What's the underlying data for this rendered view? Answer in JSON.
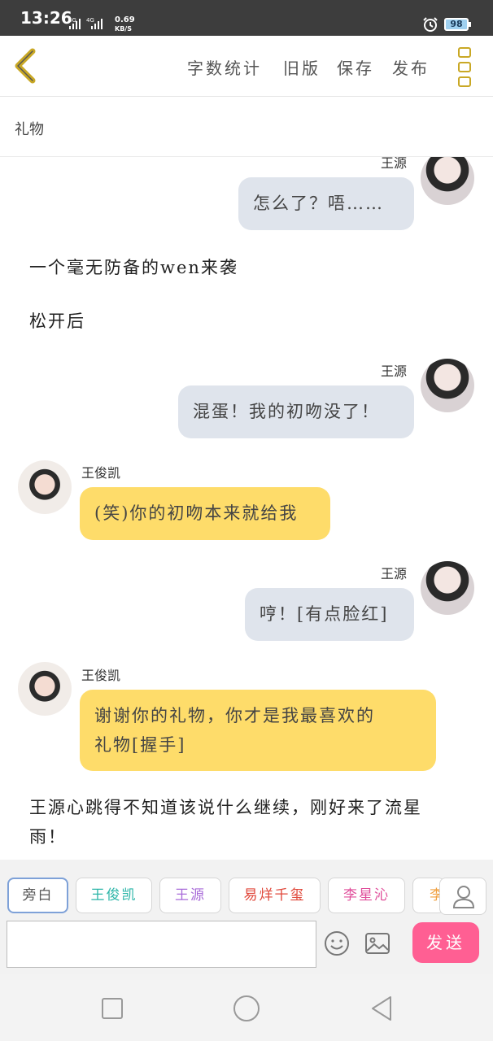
{
  "status_bar": {
    "time": "13:26",
    "network": "3G 4G",
    "speed_value": "0.69",
    "speed_unit": "KB/S",
    "battery": "98"
  },
  "toolbar": {
    "word_count": "字数统计",
    "old_version": "旧版",
    "save": "保存",
    "publish": "发布"
  },
  "document": {
    "title": "礼物"
  },
  "chat": {
    "messages": [
      {
        "speaker": "王源",
        "text": "怎么了？唔……",
        "side": "right",
        "color": "gray"
      },
      {
        "narration": "一个毫无防备的wen来袭"
      },
      {
        "narration": "松开后"
      },
      {
        "speaker": "王源",
        "text": "混蛋！我的初吻没了！",
        "side": "right",
        "color": "gray"
      },
      {
        "speaker": "王俊凯",
        "text": "(笑)你的初吻本来就给我",
        "side": "left",
        "color": "yellow"
      },
      {
        "speaker": "王源",
        "text": "哼！[有点脸红]",
        "side": "right",
        "color": "gray"
      },
      {
        "speaker": "王俊凯",
        "text_line1": "谢谢你的礼物，你才是我最喜欢的",
        "text_line2": "礼物[握手]",
        "side": "left",
        "color": "yellow"
      },
      {
        "narration_line1": "王源心跳得不知道该说什么继续，刚好来了流星",
        "narration_line2": "雨！"
      }
    ]
  },
  "editor": {
    "role_chips": [
      {
        "label": "旁白",
        "color": "#555555"
      },
      {
        "label": "王俊凯",
        "color": "#2bb5a8"
      },
      {
        "label": "王源",
        "color": "#a86bd9"
      },
      {
        "label": "易烊千玺",
        "color": "#e0473a"
      },
      {
        "label": "李星沁",
        "color": "#e04d9a"
      },
      {
        "label": "李",
        "color": "#f0a040"
      }
    ],
    "input_value": "",
    "send_label": "发送"
  },
  "colors": {
    "accent_yellow": "#fedc6a",
    "bubble_gray": "#dfe4ec",
    "send_pink": "#ff5f93",
    "icon_gold": "#c9a825"
  }
}
